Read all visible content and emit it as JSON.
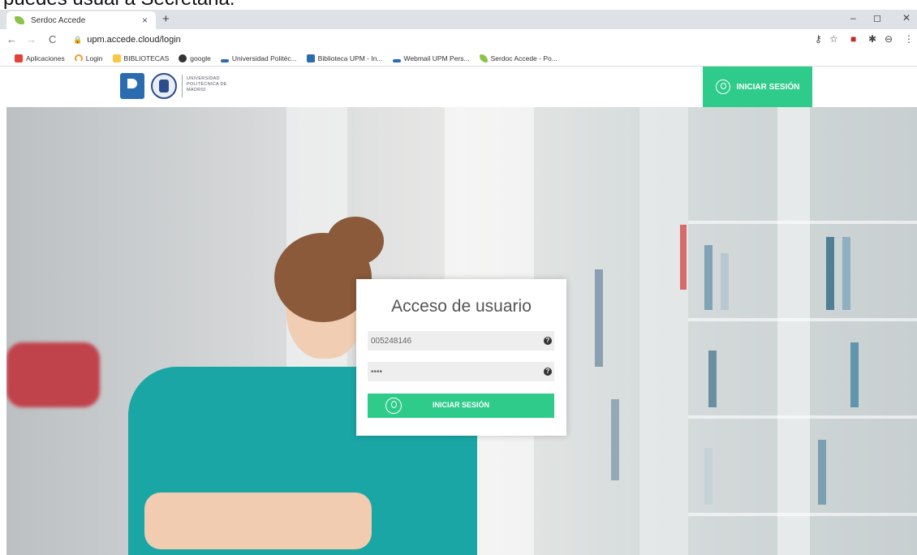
{
  "doc": {
    "cutoff_text": "puedes usual a Secretaria."
  },
  "browser": {
    "tab_title": "Serdoc Accede",
    "tab_close": "×",
    "new_tab": "+",
    "url": "upm.accede.cloud/login",
    "bookmarks": [
      {
        "label": "Aplicaciones",
        "icon": "apps-grid-icon",
        "color": "#e34234"
      },
      {
        "label": "Login",
        "icon": "login-arc-icon",
        "color": "#f29a2e"
      },
      {
        "label": "BIBLIOTECAS",
        "icon": "folder-icon",
        "color": "#f7c948"
      },
      {
        "label": "google",
        "icon": "globe-icon",
        "color": "#333333"
      },
      {
        "label": "Universidad Politéc...",
        "icon": "upload-icon",
        "color": "#2b6cb0"
      },
      {
        "label": "Biblioteca UPM - In...",
        "icon": "book-icon",
        "color": "#2b6cb0"
      },
      {
        "label": "Webmail UPM Pers...",
        "icon": "upload-icon",
        "color": "#2b6cb0"
      },
      {
        "label": "Serdoc Accede - Po...",
        "icon": "leaf-icon",
        "color": "#8bc34a"
      }
    ]
  },
  "header": {
    "university": "UNIVERSIDAD POLITÉCNICA DE MADRID",
    "login_label": "INICIAR SESIÓN"
  },
  "login": {
    "title": "Acceso de usuario",
    "username_value": "005248146",
    "password_value": "••••",
    "submit_label": "INICIAR SESIÓN",
    "help_glyph": "?"
  },
  "colors": {
    "accent": "#2fcb8b"
  }
}
